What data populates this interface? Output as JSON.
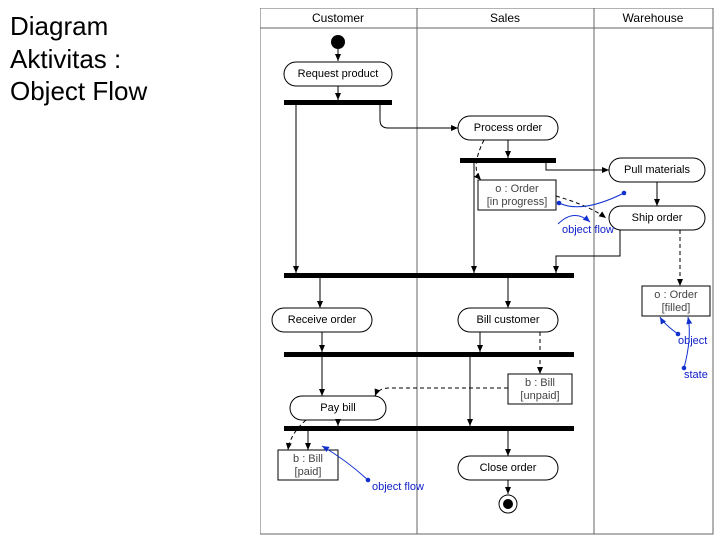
{
  "title_line1": "Diagram",
  "title_line2": "Aktivitas :",
  "title_line3": "Object Flow",
  "lanes": {
    "customer": "Customer",
    "sales": "Sales",
    "warehouse": "Warehouse"
  },
  "activities": {
    "reqProduct": "Request product",
    "processOrder": "Process order",
    "pullMaterials": "Pull materials",
    "shipOrder": "Ship order",
    "receiveOrder": "Receive order",
    "billCustomer": "Bill customer",
    "payBill": "Pay bill",
    "closeOrder": "Close order"
  },
  "objects": {
    "orderInProgress": {
      "name": "o : Order",
      "state": "[in progress]"
    },
    "orderFilled": {
      "name": "o : Order",
      "state": "[filled]"
    },
    "billUnpaid": {
      "name": "b : Bill",
      "state": "[unpaid]"
    },
    "billPaid": {
      "name": "b : Bill",
      "state": "[paid]"
    }
  },
  "annotations": {
    "objectFlow": "object flow",
    "object": "object",
    "state": "state"
  }
}
